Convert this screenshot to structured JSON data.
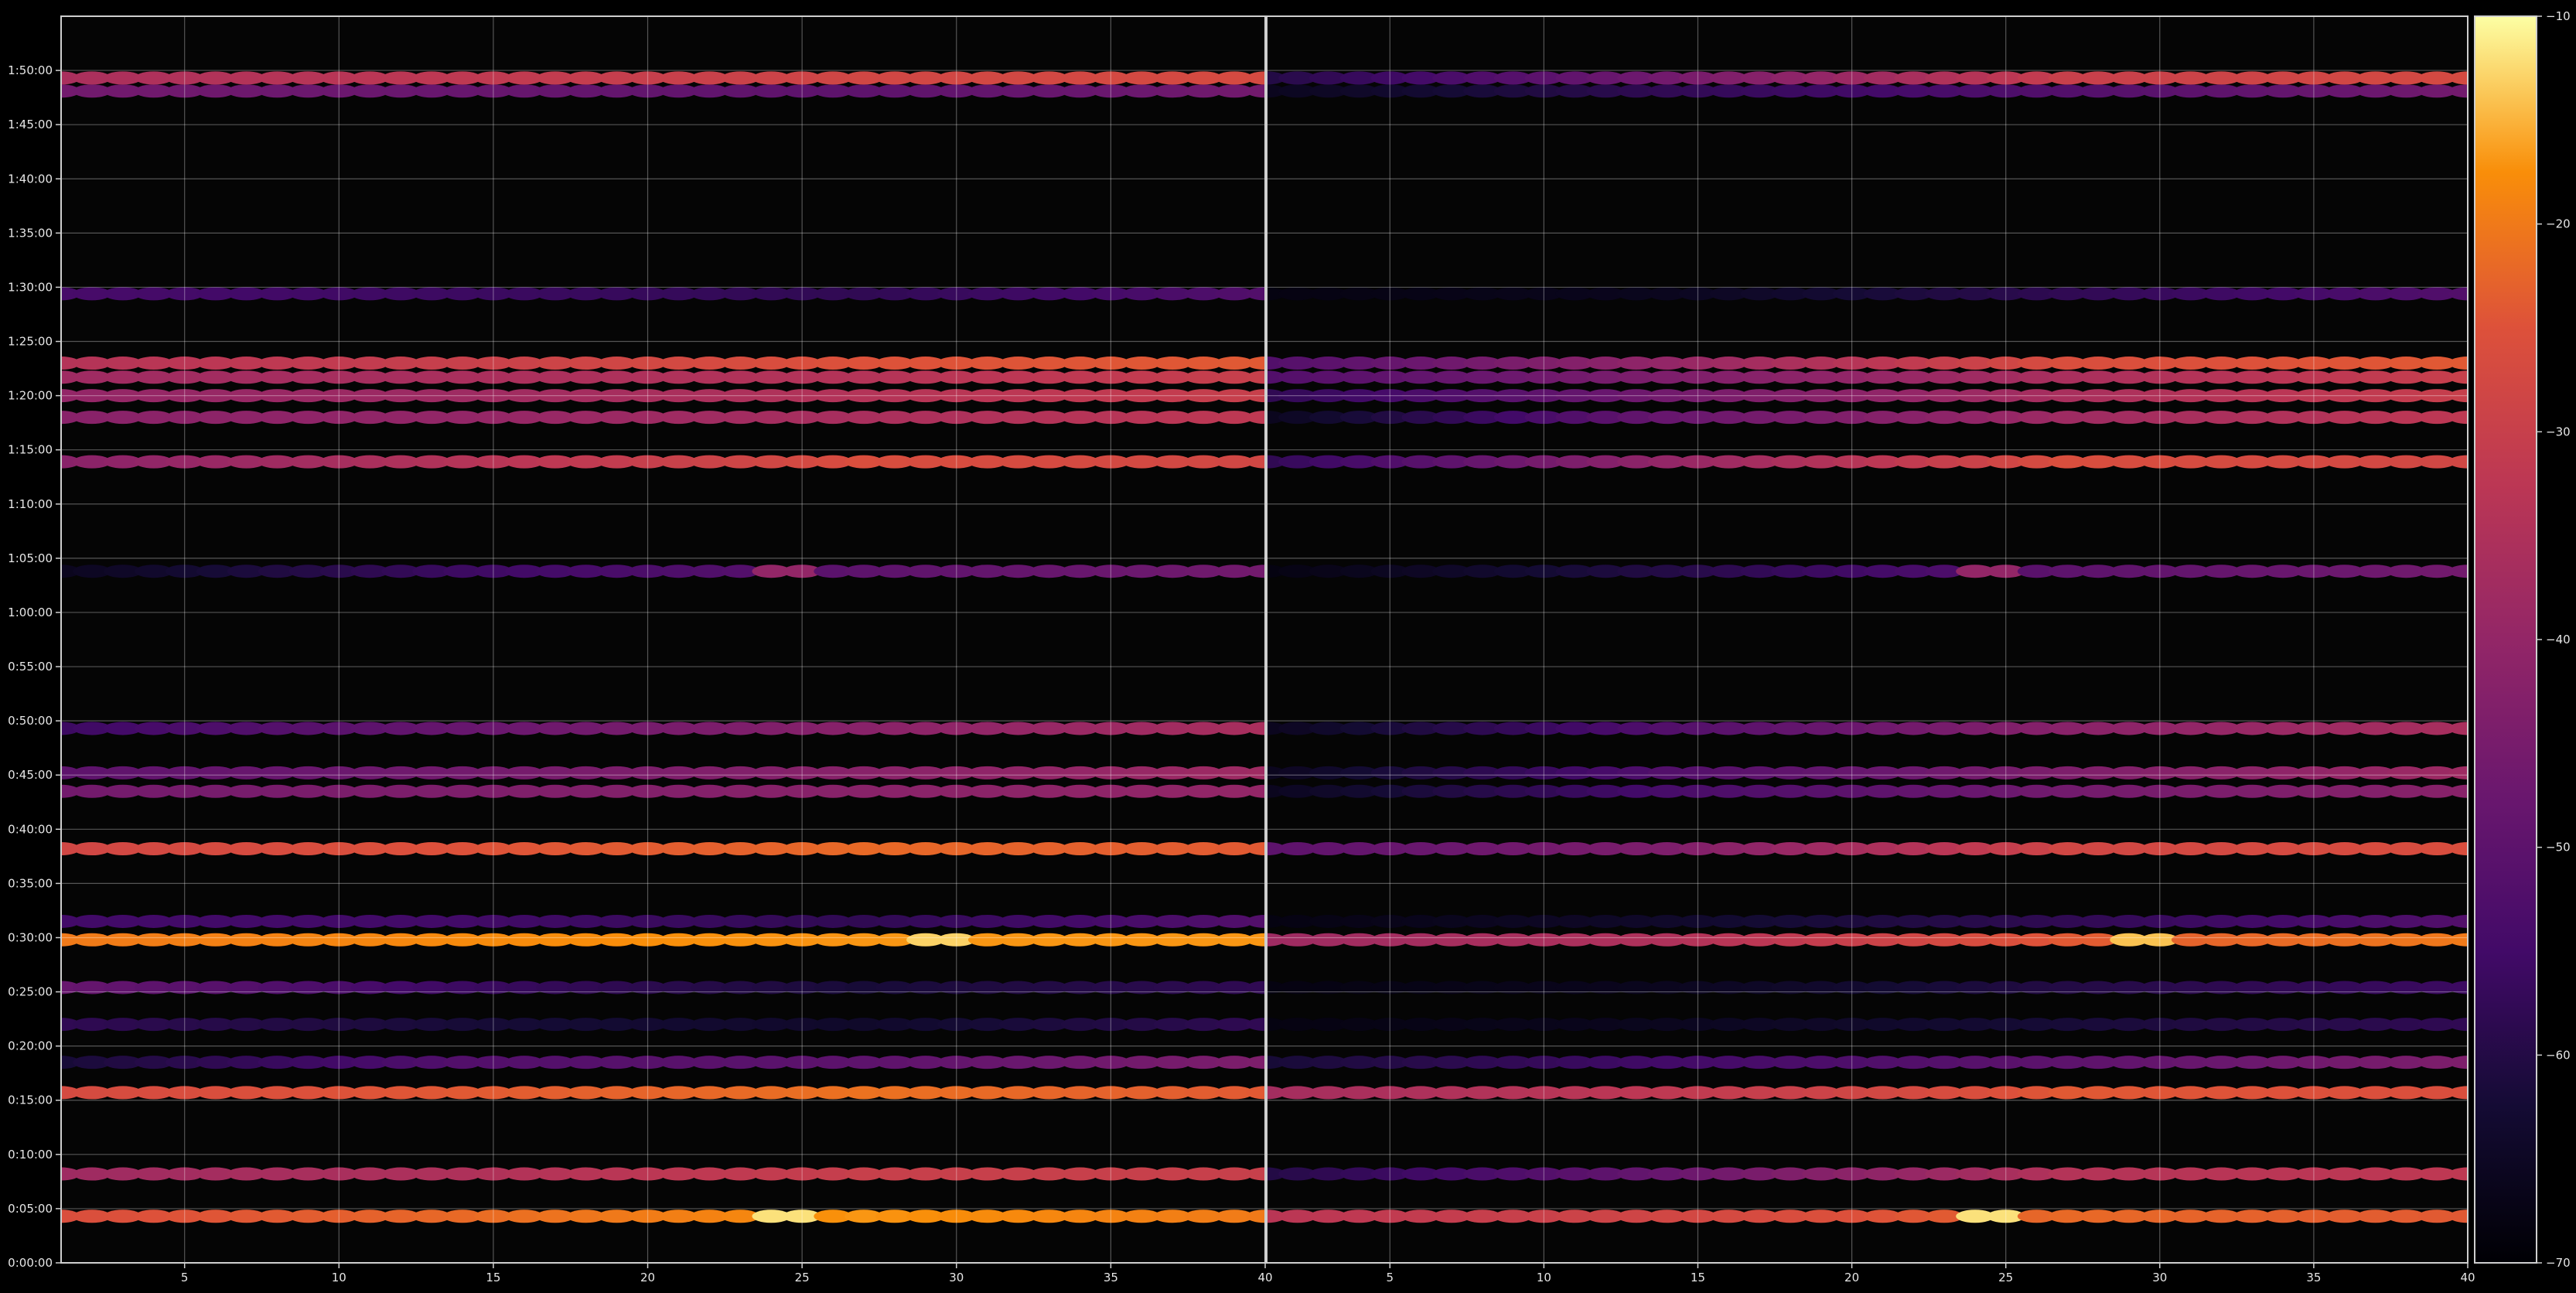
{
  "chart_data": {
    "type": "heatmap",
    "title": "",
    "xlabel": "",
    "ylabel": "",
    "panels": [
      {
        "name": "",
        "xlim": [
          1,
          40
        ],
        "xticks": [
          5,
          10,
          15,
          20,
          25,
          30,
          35,
          40
        ]
      },
      {
        "name": "",
        "xlim": [
          1,
          40
        ],
        "xticks": [
          5,
          10,
          15,
          20,
          25,
          30,
          35,
          40
        ]
      }
    ],
    "y_unit": "minutes",
    "ylim": [
      0,
      115
    ],
    "yticks": [
      0,
      5,
      10,
      15,
      20,
      25,
      30,
      35,
      40,
      45,
      50,
      55,
      60,
      65,
      70,
      75,
      80,
      85,
      90,
      95,
      100,
      105,
      110
    ],
    "ytick_labels": [
      "0:00:00",
      "0:05:00",
      "0:10:00",
      "0:15:00",
      "0:20:00",
      "0:25:00",
      "0:30:00",
      "0:35:00",
      "0:40:00",
      "0:45:00",
      "0:50:00",
      "0:55:00",
      "1:00:00",
      "1:05:00",
      "1:10:00",
      "1:15:00",
      "1:20:00",
      "1:25:00",
      "1:30:00",
      "1:35:00",
      "1:40:00",
      "1:45:00",
      "1:50:00"
    ],
    "grid": true,
    "colorbar": {
      "colormap": "inferno",
      "range": [
        -70,
        -10
      ],
      "ticks": [
        -70,
        -60,
        -50,
        -40,
        -30,
        -20,
        -10
      ],
      "tick_labels": [
        "−70",
        "−60",
        "−50",
        "−40",
        "−30",
        "−20",
        "−10"
      ]
    },
    "bands": [
      {
        "y": 4.3,
        "left": [
          -26,
          -22,
          -17,
          -20
        ],
        "right": [
          -33,
          -28,
          -22,
          -24
        ],
        "left_peak": {
          "x": 24.5,
          "v": -12
        },
        "right_peak": {
          "x": 24.5,
          "v": -12
        }
      },
      {
        "y": 8.2,
        "left": [
          -38,
          -35,
          -30,
          -30
        ],
        "right": [
          -60,
          -48,
          -34,
          -32
        ]
      },
      {
        "y": 15.7,
        "left": [
          -27,
          -24,
          -21,
          -24
        ],
        "right": [
          -37,
          -32,
          -24,
          -26
        ]
      },
      {
        "y": 18.5,
        "left": [
          -62,
          -52,
          -50,
          -44
        ],
        "right": [
          -62,
          -55,
          -50,
          -44
        ]
      },
      {
        "y": 22.0,
        "left": [
          -58,
          -62,
          -64,
          -58
        ],
        "right": [
          -68,
          -66,
          -62,
          -58
        ]
      },
      {
        "y": 25.4,
        "left": [
          -48,
          -56,
          -62,
          -58
        ],
        "right": [
          -68,
          -66,
          -60,
          -56
        ]
      },
      {
        "y": 29.8,
        "left": [
          -20,
          -18,
          -17,
          -17
        ],
        "right": [
          -38,
          -35,
          -24,
          -20
        ],
        "left_peak": {
          "x": 29.5,
          "v": -13
        },
        "right_peak": {
          "x": 29.5,
          "v": -14
        }
      },
      {
        "y": 31.5,
        "left": [
          -55,
          -55,
          -58,
          -52
        ],
        "right": [
          -68,
          -64,
          -58,
          -52
        ]
      },
      {
        "y": 38.2,
        "left": [
          -28,
          -25,
          -22,
          -24
        ],
        "right": [
          -50,
          -44,
          -28,
          -26
        ]
      },
      {
        "y": 43.5,
        "left": [
          -46,
          -44,
          -42,
          -40
        ],
        "right": [
          -66,
          -54,
          -46,
          -42
        ]
      },
      {
        "y": 45.2,
        "left": [
          -50,
          -46,
          -42,
          -38
        ],
        "right": [
          -66,
          -52,
          -44,
          -38
        ]
      },
      {
        "y": 49.3,
        "left": [
          -56,
          -48,
          -42,
          -36
        ],
        "right": [
          -66,
          -52,
          -42,
          -36
        ]
      },
      {
        "y": 63.8,
        "left": [
          -66,
          -56,
          -50,
          -46
        ],
        "right": [
          -68,
          -60,
          -50,
          -46
        ],
        "left_peak": {
          "x": 24.5,
          "v": -40
        },
        "right_peak": {
          "x": 24.5,
          "v": -40
        }
      },
      {
        "y": 73.9,
        "left": [
          -42,
          -34,
          -26,
          -28
        ],
        "right": [
          -58,
          -40,
          -26,
          -28
        ]
      },
      {
        "y": 78.0,
        "left": [
          -42,
          -40,
          -36,
          -32
        ],
        "right": [
          -66,
          -48,
          -38,
          -32
        ]
      },
      {
        "y": 80.0,
        "left": [
          -40,
          -38,
          -34,
          -30
        ],
        "right": [
          -58,
          -46,
          -36,
          -30
        ]
      },
      {
        "y": 81.7,
        "left": [
          -38,
          -36,
          -34,
          -30
        ],
        "right": [
          -52,
          -44,
          -36,
          -30
        ]
      },
      {
        "y": 83.0,
        "left": [
          -34,
          -30,
          -25,
          -24
        ],
        "right": [
          -52,
          -40,
          -26,
          -24
        ]
      },
      {
        "y": 89.4,
        "left": [
          -54,
          -56,
          -58,
          -52
        ],
        "right": [
          -68,
          -66,
          -58,
          -52
        ]
      },
      {
        "y": 108.1,
        "left": [
          -46,
          -48,
          -50,
          -46
        ],
        "right": [
          -66,
          -58,
          -52,
          -46
        ]
      },
      {
        "y": 109.3,
        "left": [
          -36,
          -32,
          -28,
          -27
        ],
        "right": [
          -60,
          -46,
          -30,
          -27
        ]
      }
    ]
  }
}
